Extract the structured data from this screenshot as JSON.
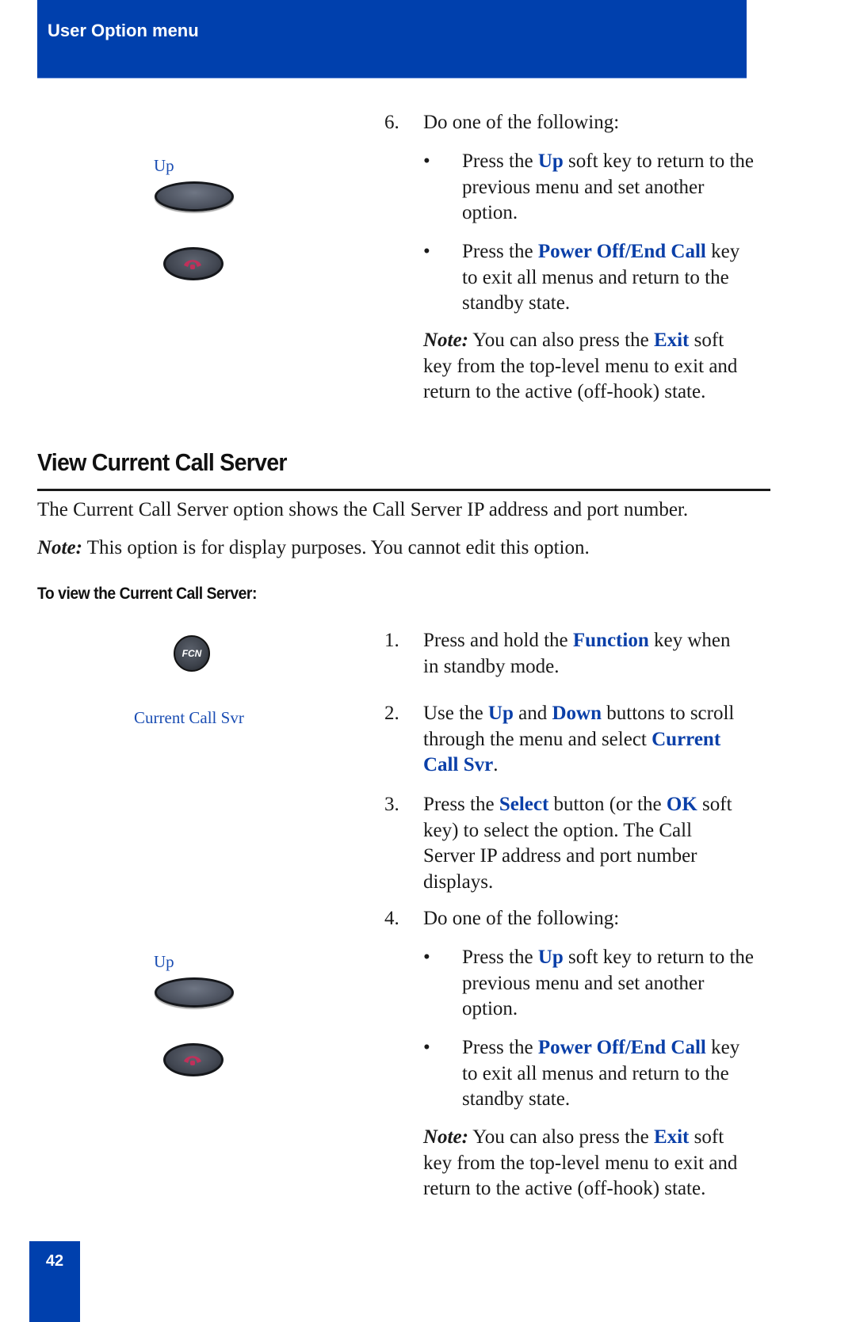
{
  "header": {
    "title": "User Option menu"
  },
  "top_block": {
    "softkey_label": "Up",
    "step6": {
      "number": "6.",
      "text": "Do one of the following:",
      "bullets": [
        {
          "pre": "Press the ",
          "key": "Up",
          "post1": " soft key to return to the",
          "post2": "previous menu and set another",
          "post3": "option."
        },
        {
          "pre": "Press the ",
          "key": "Power Off/End Call",
          "post1": " key",
          "post2": "to exit all menus and return to the",
          "post3": "standby state."
        }
      ],
      "note": {
        "label": "Note:",
        "pre": " You can also press the ",
        "key": "Exit",
        "post1": " soft",
        "post2": "key from the top-level menu to exit and",
        "post3": "return to the active (off-hook) state."
      }
    }
  },
  "section": {
    "title": "View Current Call Server",
    "intro": "The Current Call Server option shows the Call Server IP address and port number.",
    "note_label": "Note:",
    "note_text": " This option is for display purposes. You cannot edit this option.",
    "procedure_heading": "To view the Current Call Server:",
    "fcn_key_label": "FCN",
    "display_label": "Current Call Svr",
    "softkey_label": "Up",
    "steps": [
      {
        "number": "1.",
        "l1_pre": "Press and hold the ",
        "l1_key": "Function",
        "l1_post": " key when",
        "l2": "in standby mode."
      },
      {
        "number": "2.",
        "l1_pre": "Use the ",
        "l1_key1": "Up",
        "l1_mid": " and ",
        "l1_key2": "Down",
        "l1_post": " buttons to scroll",
        "l2_pre": "through the menu and select ",
        "l2_key": "Current",
        "l3_key": "Call Svr",
        "l3_post": "."
      },
      {
        "number": "3.",
        "l1_pre": "Press the ",
        "l1_key1": "Select",
        "l1_mid": " button (or the ",
        "l1_key2": "OK",
        "l1_post": " soft",
        "l2": "key) to select the option. The Call",
        "l3": "Server IP address and port number",
        "l4": "displays."
      },
      {
        "number": "4.",
        "text": "Do one of the following:",
        "bullets": [
          {
            "pre": "Press the ",
            "key": "Up",
            "post1": " soft key to return to the",
            "post2": "previous menu and set another",
            "post3": "option."
          },
          {
            "pre": "Press the ",
            "key": "Power Off/End Call",
            "post1": " key",
            "post2": "to exit all menus and return to the",
            "post3": "standby state."
          }
        ],
        "note": {
          "label": "Note:",
          "pre": " You can also press the ",
          "key": "Exit",
          "post1": " soft",
          "post2": "key from the top-level menu to exit and",
          "post3": "return to the active (off-hook) state."
        }
      }
    ]
  },
  "footer": {
    "page_number": "42"
  }
}
